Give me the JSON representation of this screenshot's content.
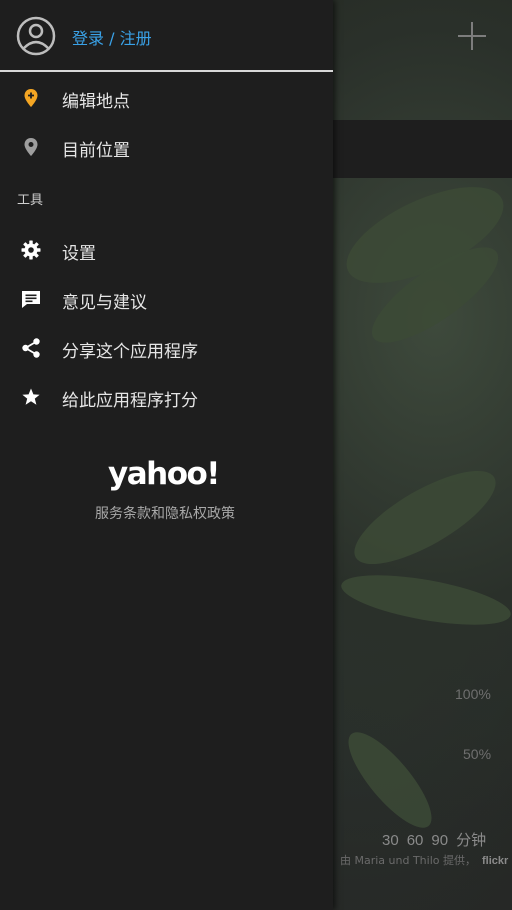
{
  "colors": {
    "accent": "#3aa2e8",
    "pin_orange": "#f5a623",
    "drawer_bg": "#1e1e1e",
    "text_primary": "#e6e6e6"
  },
  "header": {
    "login_label": "登录 / 注册",
    "avatar_icon": "account-circle-icon"
  },
  "menu": {
    "edit_locations": {
      "label": "编辑地点",
      "icon": "location-pin-icon"
    },
    "current_location": {
      "label": "目前位置",
      "icon": "location-pin-icon"
    },
    "tools_section": "工具",
    "settings": {
      "label": "设置",
      "icon": "gear-icon"
    },
    "feedback": {
      "label": "意见与建议",
      "icon": "feedback-icon"
    },
    "share": {
      "label": "分享这个应用程序",
      "icon": "share-icon"
    },
    "rate": {
      "label": "给此应用程序打分",
      "icon": "star-icon"
    }
  },
  "footer": {
    "logo_text": "yahoo!",
    "terms_label": "服务条款和隐私权政策"
  },
  "background": {
    "percent_100": "100%",
    "percent_50": "50%",
    "ticks": [
      "30",
      "60",
      "90",
      "分钟"
    ],
    "photo_credit": "由 Maria und Thilo 提供，",
    "photo_source": "flickr"
  }
}
